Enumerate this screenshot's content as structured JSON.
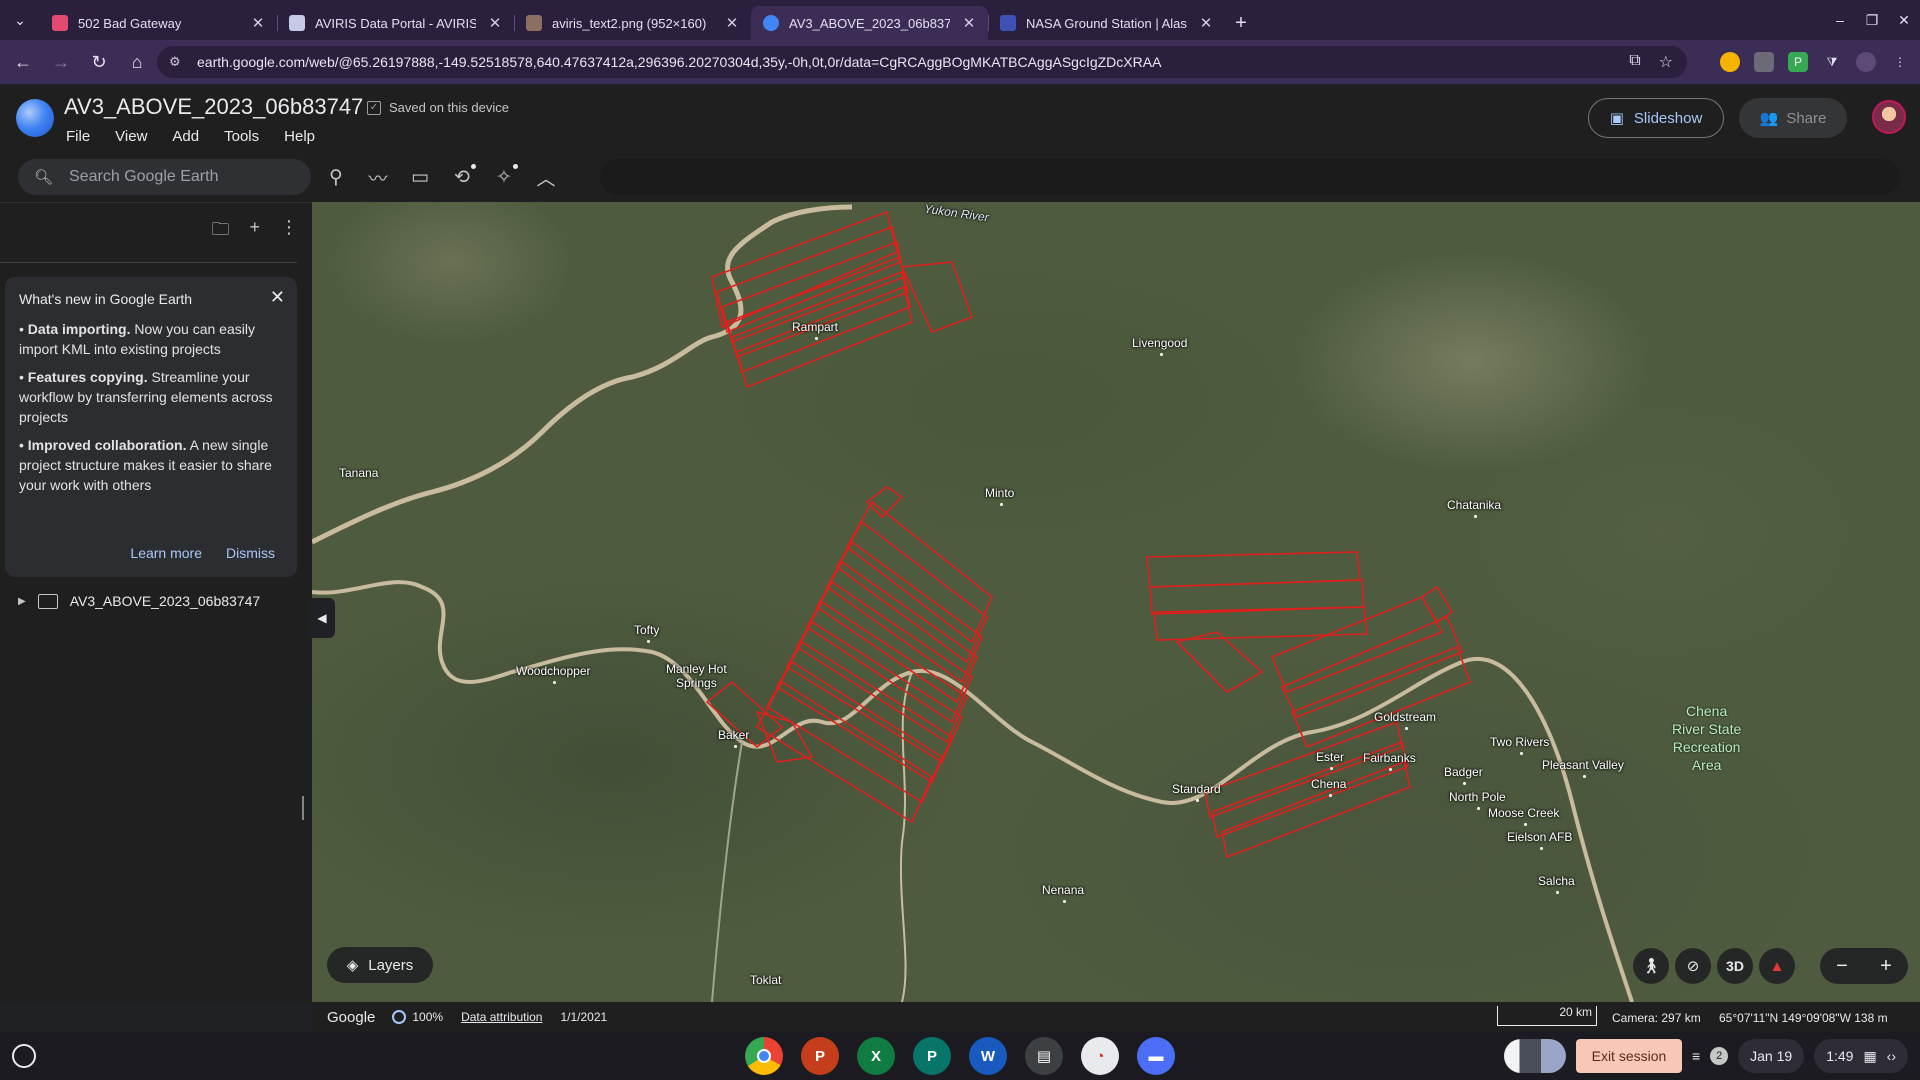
{
  "browser": {
    "tabs": [
      {
        "title": "502 Bad Gateway",
        "fav_color": "#e34a6f",
        "active": false
      },
      {
        "title": "AVIRIS Data Portal - AVIRIS",
        "fav_color": "#c5cae9",
        "active": false
      },
      {
        "title": "aviris_text2.png (952×160)",
        "fav_color": "#8d6e63",
        "active": false
      },
      {
        "title": "AV3_ABOVE_2023_06b83747",
        "fav_color": "#4285f4",
        "active": true
      },
      {
        "title": "NASA Ground Station | Alaska",
        "fav_color": "#3f51b5",
        "active": false
      }
    ],
    "url": "earth.google.com/web/@65.26197888,-149.52518578,640.47637412a,296396.20270304d,35y,-0h,0t,0r/data=CgRCAggBOgMKATBCAggASgcIgZDcXRAA"
  },
  "app": {
    "project_title": "AV3_ABOVE_2023_06b83747",
    "saved_status": "Saved on this device",
    "menus": [
      "File",
      "View",
      "Add",
      "Tools",
      "Help"
    ],
    "slideshow_label": "Slideshow",
    "share_label": "Share"
  },
  "toolbar": {
    "search_placeholder": "Search Google Earth"
  },
  "sidebar": {
    "whats_new": {
      "title": "What's new in Google Earth",
      "items": [
        {
          "bold": "Data importing.",
          "text": " Now you can easily import KML into existing projects"
        },
        {
          "bold": "Features copying.",
          "text": " Streamline your workflow by transferring elements across projects"
        },
        {
          "bold": "Improved collaboration.",
          "text": " A new single project structure makes it easier to share your work with others"
        }
      ],
      "learn_more": "Learn more",
      "dismiss": "Dismiss"
    },
    "tree_item": "AV3_ABOVE_2023_06b83747"
  },
  "map": {
    "labels": {
      "yukon": "Yukon River",
      "rampart": "Rampart",
      "livengood": "Livengood",
      "tanana": "Tanana",
      "minto": "Minto",
      "chatanika": "Chatanika",
      "tofty": "Tofty",
      "woodchopper": "Woodchopper",
      "manley": "Manley Hot\nSprings",
      "baker": "Baker",
      "goldstream": "Goldstream",
      "two_rivers": "Two Rivers",
      "pleasant_valley": "Pleasant Valley",
      "ester": "Ester",
      "fairbanks": "Fairbanks",
      "badger": "Badger",
      "chena": "Chena",
      "standard": "Standard",
      "north_pole": "North Pole",
      "moose_creek": "Moose Creek",
      "eielson": "Eielson AFB",
      "salcha": "Salcha",
      "nenana": "Nenana",
      "toklat": "Toklat",
      "chena_park": "Chena\nRiver State\nRecreation\nArea"
    },
    "layers_label": "Layers",
    "view_3d": "3D",
    "flightline_color": "#e0201c"
  },
  "status": {
    "brand": "Google",
    "load_percent": "100%",
    "attribution": "Data attribution",
    "imagery_date": "1/1/2021",
    "scale": "20 km",
    "camera": "Camera: 297 km",
    "coords": "65°07'11\"N 149°09'08\"W  138 m"
  },
  "shelf": {
    "exit_label": "Exit session",
    "notif_count": "2",
    "date": "Jan 19",
    "time": "1:49"
  }
}
